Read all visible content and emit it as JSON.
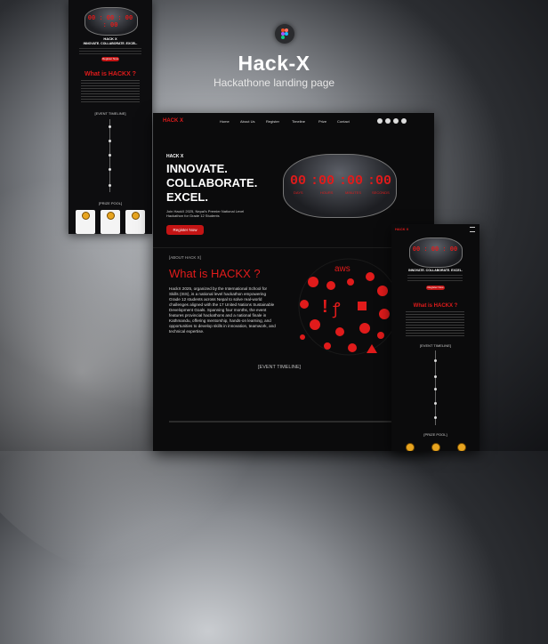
{
  "header": {
    "title": "Hack-X",
    "subtitle": "Hackathone landing page",
    "logo_icon": "figma-logo-icon"
  },
  "desktop": {
    "logo": "HACK X",
    "nav": [
      "Home",
      "About Us",
      "Register",
      "Timeline",
      "Prize",
      "Contact"
    ],
    "social_icons": [
      "twitter-icon",
      "github-icon",
      "instagram-icon",
      "discord-icon"
    ],
    "hero": {
      "kicker": "HACK X",
      "heading": [
        "INNOVATE.",
        "COLLABORATE.",
        "EXCEL."
      ],
      "description": "Join HackX 2025, Nepal's Premier National Level Hackathon for Grade 12 Students",
      "cta": "Register Now",
      "countdown": [
        "00",
        "00",
        "00",
        "00"
      ],
      "units": [
        "DAYS",
        "HOURS",
        "MINUTES",
        "SECONDS"
      ]
    },
    "about": {
      "tag": "[ABOUT HACK X]",
      "title": "What is HACKX ?",
      "body": "HackX 2025, organized by the International School for Skills (ISS), is a national level hackathon empowering Grade 12 students across Nepal to solve real-world challenges aligned with the 17 United Nations Sustainable Development Goals. Spanning four months, the event features provincial hackathons and a national finale in Kathmandu, offering mentorship, hands-on learning, and opportunities to develop skills in innovation, teamwork, and technical expertise."
    },
    "timeline_label": "[EVENT TIMELINE]"
  },
  "phone": {
    "countdown": "00 : 00 : 00 : 00",
    "kicker": "HACK X",
    "heading": "INNOVATE. COLLABORATE. EXCEL.",
    "cta": "Register Now",
    "about_title": "What is HACKX ?",
    "timeline_label": "[EVENT TIMELINE]",
    "prize_label": "[PRIZE POOL]"
  },
  "tablet": {
    "logo": "HACK X",
    "countdown": "00 : 00 : 00",
    "heading": "INNOVATE. COLLABORATE. EXCEL.",
    "cta": "Register Now",
    "about_title": "What is HACKX ?",
    "timeline_label": "[EVENT TIMELINE]",
    "prize_label": "[PRIZE POOL]"
  }
}
